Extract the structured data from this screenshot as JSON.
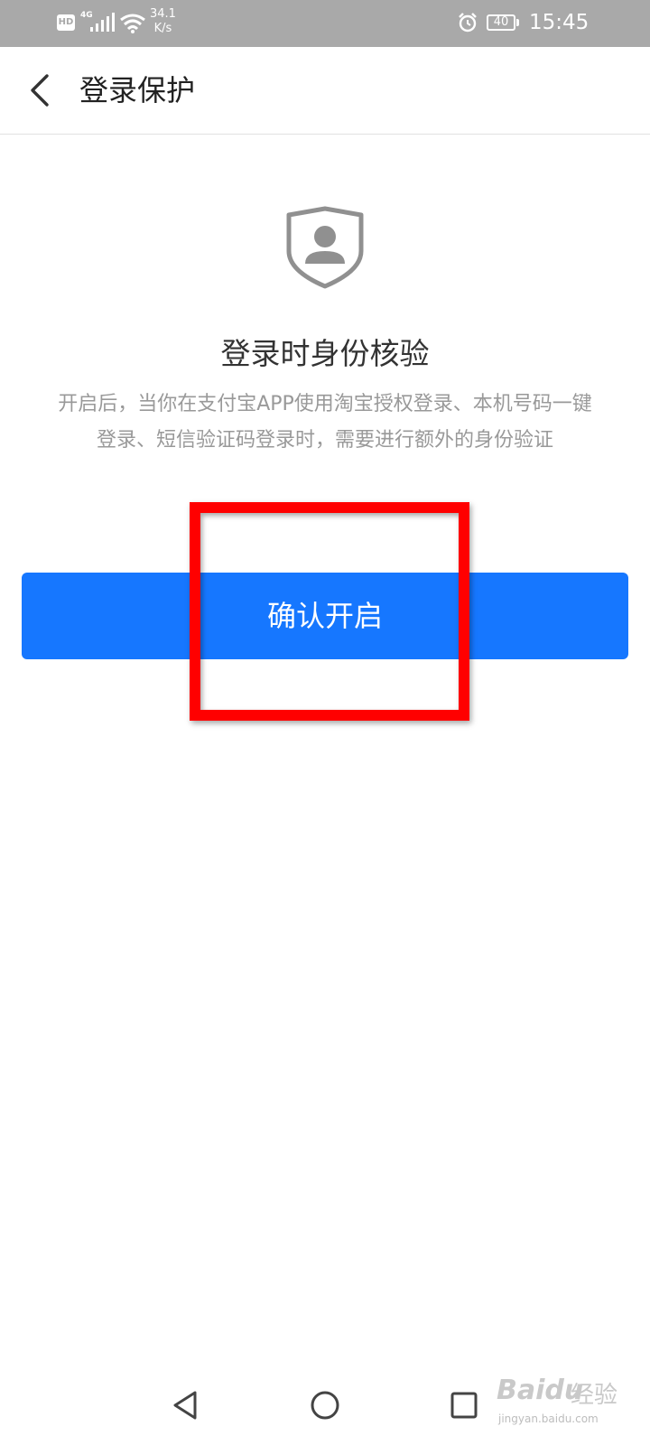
{
  "status_bar": {
    "hd_label": "HD",
    "network_label": "4G",
    "speed_value": "34.1",
    "speed_unit": "K/s",
    "battery_level": "40",
    "time": "15:45"
  },
  "header": {
    "title": "登录保护",
    "back_icon": "chevron-left-icon"
  },
  "main": {
    "icon": "shield-user-icon",
    "section_title": "登录时身份核验",
    "description_line1": "开启后，当你在支付宝APP使用淘宝授权登录、本机号码一键",
    "description_line2": "登录、短信验证码登录时，需要进行额外的身份验证",
    "confirm_button_label": "确认开启"
  },
  "colors": {
    "accent": "#1677ff",
    "highlight": "#ff0000",
    "status_bar_bg": "#a9a9a9"
  },
  "nav_bar": {
    "back_icon": "triangle-back-icon",
    "home_icon": "circle-home-icon",
    "recents_icon": "square-recents-icon"
  },
  "watermark": {
    "logo": "Bai",
    "logo_suffix": "du",
    "text": "经验",
    "url": "jingyan.baidu.com"
  }
}
